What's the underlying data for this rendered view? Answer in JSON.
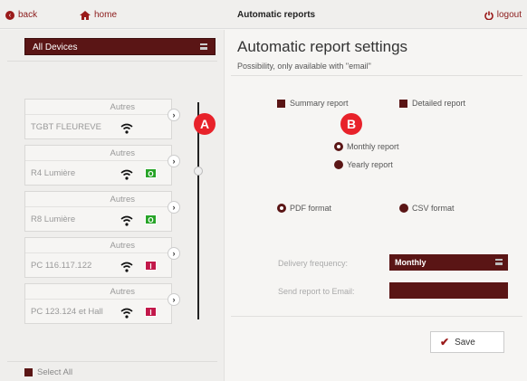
{
  "topbar": {
    "back_label": "back",
    "home_label": "home",
    "title": "Automatic reports",
    "logout_label": "logout"
  },
  "sidebar": {
    "device_select": "All Devices",
    "devices": [
      {
        "category": "Autres",
        "name": "TGBT FLEUREVE",
        "status": ""
      },
      {
        "category": "Autres",
        "name": "R4 Lumière",
        "status": "O"
      },
      {
        "category": "Autres",
        "name": "R8 Lumière",
        "status": "O"
      },
      {
        "category": "Autres",
        "name": "PC 116.117.122",
        "status": "I"
      },
      {
        "category": "Autres",
        "name": "PC 123.124 et Hall",
        "status": "I"
      }
    ],
    "select_all": "Select All"
  },
  "badges": {
    "a": "A",
    "b": "B"
  },
  "main": {
    "title": "Automatic report settings",
    "subtitle": "Possibility, only available with \"email\"",
    "report_types": {
      "summary": "Summary report",
      "detailed": "Detailed report"
    },
    "periods": {
      "monthly": "Monthly report",
      "yearly": "Yearly report",
      "selected": "monthly"
    },
    "formats": {
      "pdf": "PDF format",
      "csv": "CSV format",
      "selected": "pdf"
    },
    "delivery_label": "Delivery frequency:",
    "delivery_value": "Monthly",
    "email_label": "Send report to Email:",
    "email_value": "",
    "save_label": "Save"
  },
  "colors": {
    "accent": "#5a1515",
    "badge": "#e8222a",
    "ok": "#28a428",
    "error": "#c2184a"
  }
}
